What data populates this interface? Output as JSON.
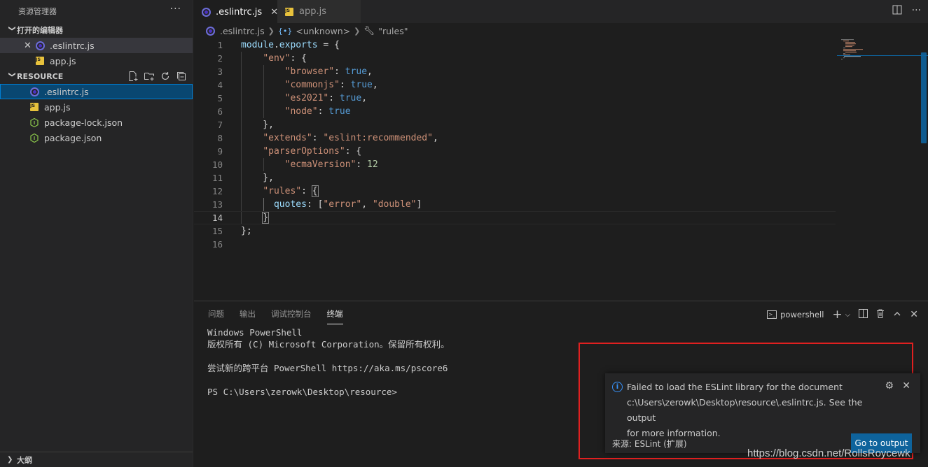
{
  "explorer": {
    "title": "资源管理器",
    "more": "···",
    "open_editors_label": "打开的编辑器",
    "open_editors": [
      {
        "name": ".eslintrc.js",
        "icon": "eslint-icon"
      },
      {
        "name": "app.js",
        "icon": "js-file-icon"
      }
    ],
    "folder_label": "RESOURCE",
    "files": [
      {
        "name": ".eslintrc.js",
        "icon": "eslint-icon"
      },
      {
        "name": "app.js",
        "icon": "js-file-icon"
      },
      {
        "name": "package-lock.json",
        "icon": "nodejs-icon"
      },
      {
        "name": "package.json",
        "icon": "nodejs-icon"
      }
    ],
    "outline_label": "大纲"
  },
  "tabs": [
    {
      "label": ".eslintrc.js",
      "active": true
    },
    {
      "label": "app.js",
      "active": false
    }
  ],
  "breadcrumb": {
    "file": ".eslintrc.js",
    "symbol": "<unknown>",
    "property": "\"rules\""
  },
  "editor": {
    "lines": [
      {
        "n": "1"
      },
      {
        "n": "2"
      },
      {
        "n": "3"
      },
      {
        "n": "4"
      },
      {
        "n": "5"
      },
      {
        "n": "6"
      },
      {
        "n": "7"
      },
      {
        "n": "8"
      },
      {
        "n": "9"
      },
      {
        "n": "10"
      },
      {
        "n": "11"
      },
      {
        "n": "12"
      },
      {
        "n": "13"
      },
      {
        "n": "14"
      },
      {
        "n": "15"
      },
      {
        "n": "16"
      }
    ],
    "current_line": "14"
  },
  "panel": {
    "tabs": [
      "问题",
      "输出",
      "调试控制台",
      "终端"
    ],
    "active_tab": "终端",
    "terminal_name": "powershell",
    "terminal_lines": [
      "Windows PowerShell",
      "版权所有 (C) Microsoft Corporation。保留所有权利。",
      "",
      "尝试新的跨平台 PowerShell https://aka.ms/pscore6",
      "",
      "PS C:\\Users\\zerowk\\Desktop\\resource>"
    ]
  },
  "notification": {
    "line1": "Failed to load the ESLint library for the document",
    "line2": "c:\\Users\\zerowk\\Desktop\\resource\\.eslintrc.js. See the output",
    "line3": "for more information.",
    "source": "来源: ESLint (扩展)",
    "button": "Go to output"
  },
  "watermark": "https://blog.csdn.net/RollsRoycewk",
  "colors": {
    "accent": "#0e639c",
    "highlight_box": "#e02020",
    "info": "#3794ff"
  }
}
